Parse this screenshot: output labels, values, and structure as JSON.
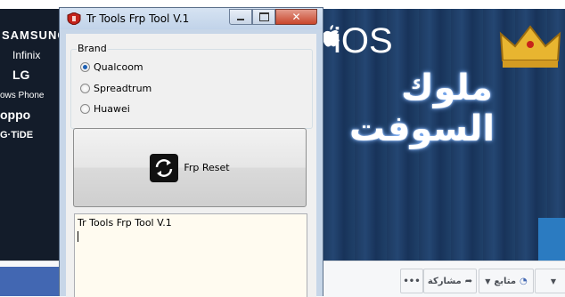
{
  "window": {
    "title": "Tr Tools Frp Tool V.1",
    "brand_group_label": "Brand",
    "options": [
      {
        "label": "Qualcoom",
        "selected": true
      },
      {
        "label": "Spreadtrum",
        "selected": false
      },
      {
        "label": "Huawei",
        "selected": false
      }
    ],
    "frp_button_label": "Frp Reset",
    "log_text": "Tr Tools Frp Tool V.1"
  },
  "background": {
    "brands": [
      "SAMSUNG",
      "Infinix",
      "LG",
      "ows Phone",
      "oppo",
      "G·TiDE"
    ],
    "ios_label": "iOS",
    "arabic_line1": "ملوك",
    "arabic_line2": "السوفت",
    "fb_buttons": {
      "share": "مشاركة",
      "follow": "متابع",
      "more": "•••"
    }
  },
  "colors": {
    "titlebar": "#c7d6e8",
    "close_button": "#c9462c",
    "log_background": "#fffbf0",
    "radio_selected": "#1c5fb3",
    "cover_background": "#11233d"
  }
}
